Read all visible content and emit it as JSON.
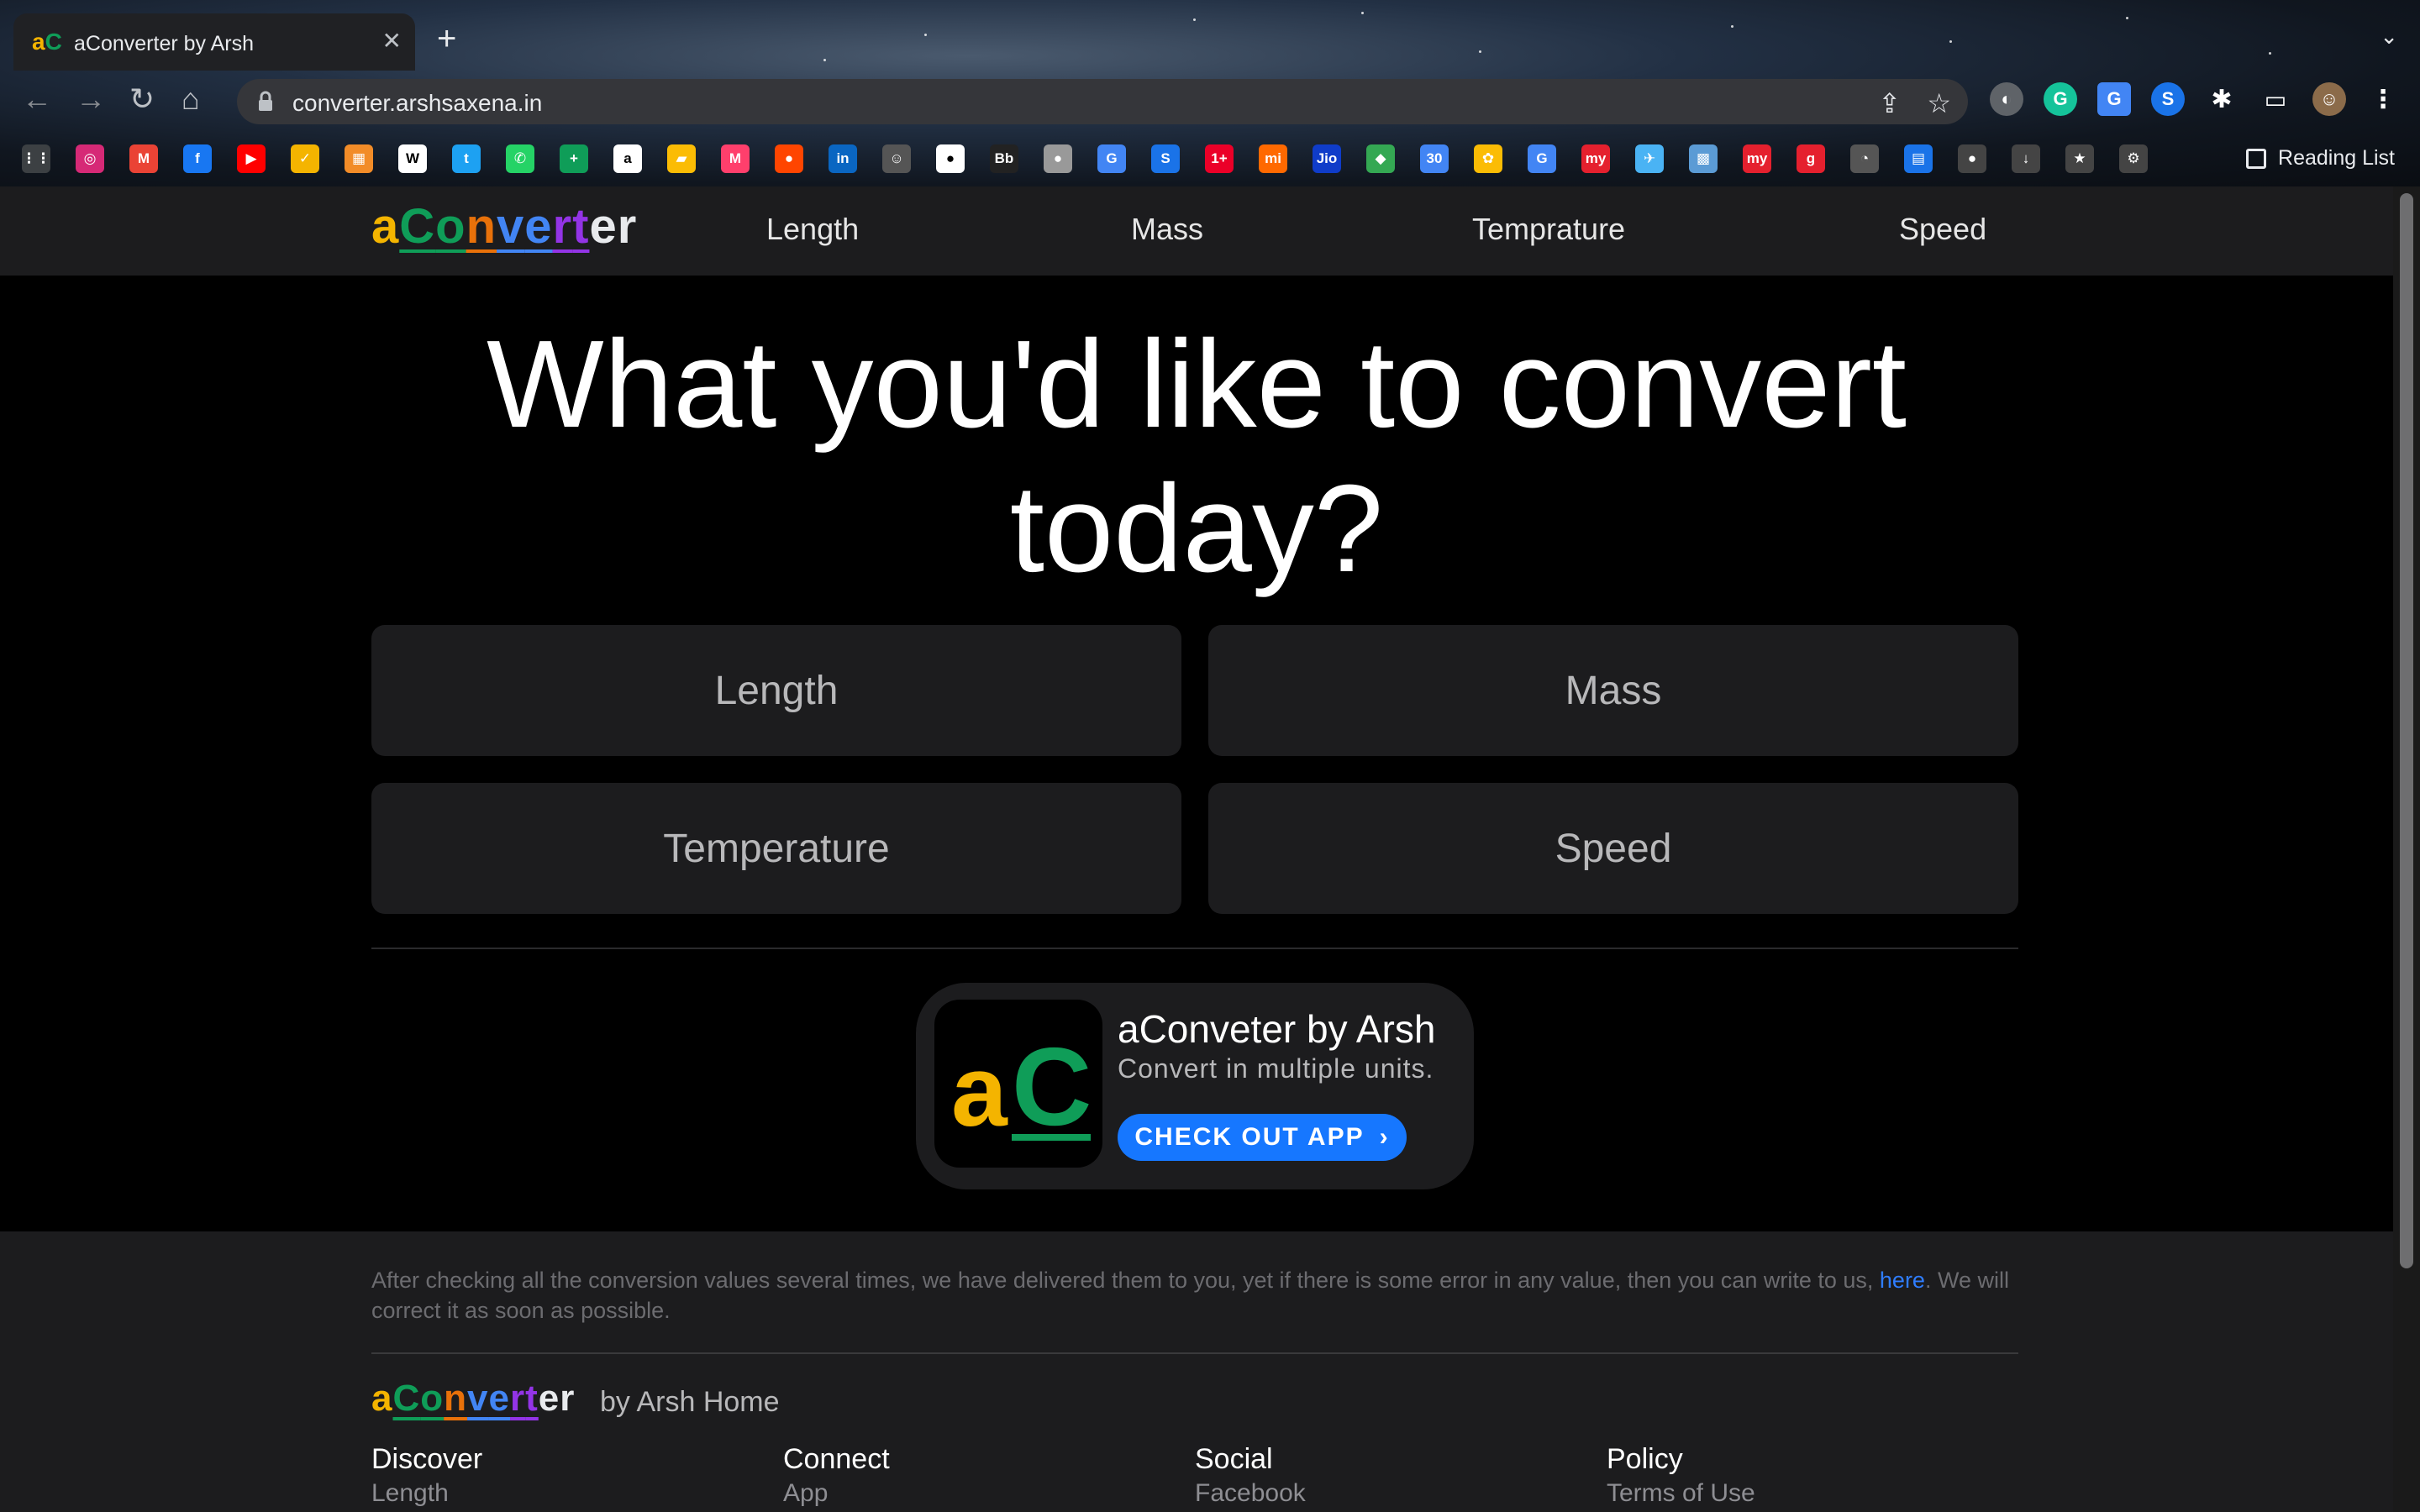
{
  "browser": {
    "tab_title": "aConverter by Arsh",
    "tab_favicon": "aC",
    "url": "converter.arshsaxena.in",
    "reading_list_label": "Reading List",
    "bookmarks": [
      {
        "name": "apps-icon",
        "color": "#3c4043",
        "glyph": "⋮⋮"
      },
      {
        "name": "instagram-icon",
        "color": "#d62976",
        "glyph": "◎"
      },
      {
        "name": "gmail-icon",
        "color": "#ea4335",
        "glyph": "M"
      },
      {
        "name": "facebook-icon",
        "color": "#1877f2",
        "glyph": "f"
      },
      {
        "name": "youtube-icon",
        "color": "#ff0000",
        "glyph": "▶"
      },
      {
        "name": "check-icon",
        "color": "#f4b400",
        "glyph": "✓"
      },
      {
        "name": "slides-icon",
        "color": "#f28c28",
        "glyph": "▦"
      },
      {
        "name": "wikipedia-icon",
        "color": "#ffffff",
        "glyph": "W"
      },
      {
        "name": "twitter-icon",
        "color": "#1da1f2",
        "glyph": "t"
      },
      {
        "name": "whatsapp-icon",
        "color": "#25d366",
        "glyph": "✆"
      },
      {
        "name": "sheets-icon",
        "color": "#0f9d58",
        "glyph": "+"
      },
      {
        "name": "amazon-icon",
        "color": "#ffffff",
        "glyph": "a"
      },
      {
        "name": "keep-icon",
        "color": "#fbbc04",
        "glyph": "▰"
      },
      {
        "name": "myntra-icon",
        "color": "#ff3f6c",
        "glyph": "M"
      },
      {
        "name": "reddit-icon",
        "color": "#ff4500",
        "glyph": "●"
      },
      {
        "name": "linkedin-icon",
        "color": "#0a66c2",
        "glyph": "in"
      },
      {
        "name": "profile-icon",
        "color": "#555555",
        "glyph": "☺"
      },
      {
        "name": "github-icon",
        "color": "#ffffff",
        "glyph": "●"
      },
      {
        "name": "bb-icon",
        "color": "#222222",
        "glyph": "Bb"
      },
      {
        "name": "apple-icon",
        "color": "#999999",
        "glyph": "●"
      },
      {
        "name": "google-icon",
        "color": "#4285f4",
        "glyph": "G"
      },
      {
        "name": "s-icon",
        "color": "#1a73e8",
        "glyph": "S"
      },
      {
        "name": "oneplus-icon",
        "color": "#eb0028",
        "glyph": "1+"
      },
      {
        "name": "mi-icon",
        "color": "#ff6900",
        "glyph": "mi"
      },
      {
        "name": "jio-icon",
        "color": "#0f3cc9",
        "glyph": "Jio"
      },
      {
        "name": "maps-icon",
        "color": "#34a853",
        "glyph": "◆"
      },
      {
        "name": "calendar-icon",
        "color": "#4285f4",
        "glyph": "30"
      },
      {
        "name": "photos-icon",
        "color": "#fbbc04",
        "glyph": "✿"
      },
      {
        "name": "translate-icon",
        "color": "#4285f4",
        "glyph": "G"
      },
      {
        "name": "makemytrip-icon",
        "color": "#e5202e",
        "glyph": "my"
      },
      {
        "name": "flight-icon",
        "color": "#4ab3f4",
        "glyph": "✈"
      },
      {
        "name": "travel-icon",
        "color": "#5b9bd5",
        "glyph": "▩"
      },
      {
        "name": "myntra-my-icon",
        "color": "#e5202e",
        "glyph": "my"
      },
      {
        "name": "g-icon",
        "color": "#e5202e",
        "glyph": "g"
      },
      {
        "name": "speed-icon",
        "color": "#555555",
        "glyph": "◔"
      },
      {
        "name": "doc-icon",
        "color": "#1a73e8",
        "glyph": "▤"
      },
      {
        "name": "github-gray-icon",
        "color": "#444444",
        "glyph": "●"
      },
      {
        "name": "download-icon",
        "color": "#444444",
        "glyph": "↓"
      },
      {
        "name": "star-icon",
        "color": "#444444",
        "glyph": "★"
      },
      {
        "name": "settings-icon",
        "color": "#444444",
        "glyph": "⚙"
      }
    ]
  },
  "navbar": {
    "logo": "aConverter",
    "links": [
      "Length",
      "Mass",
      "Temprature",
      "Speed"
    ]
  },
  "hero": {
    "title_line1": "What you'd like to convert",
    "title_line2": "today?"
  },
  "cards": [
    "Length",
    "Mass",
    "Temperature",
    "Speed"
  ],
  "promo": {
    "title": "aConveter by Arsh",
    "subtitle": "Convert in multiple units.",
    "button_label": "CHECK OUT APP",
    "button_icon": "›"
  },
  "footer": {
    "disclaimer": "After checking all the conversion values several times, we have delivered them to you, yet if there is some error in any value, then you can write to us,",
    "disclaimer_link": "here",
    "disclaimer_end": ". We will correct it as soon as possible.",
    "brand_by": "by Arsh Home",
    "columns": [
      {
        "title": "Discover",
        "item": "Length"
      },
      {
        "title": "Connect",
        "item": "App"
      },
      {
        "title": "Social",
        "item": "Facebook"
      },
      {
        "title": "Policy",
        "item": "Terms of Use"
      }
    ]
  },
  "colors": {
    "logo_a": "#f4b400",
    "logo_C": "#0f9d58",
    "logo_o": "#0f9d58",
    "logo_n": "#e8710a",
    "logo_v": "#4285f4",
    "logo_e": "#4285f4",
    "logo_r": "#9334e6",
    "logo_t": "#9334e6",
    "link": "#2f7dff",
    "button": "#1677ff"
  }
}
